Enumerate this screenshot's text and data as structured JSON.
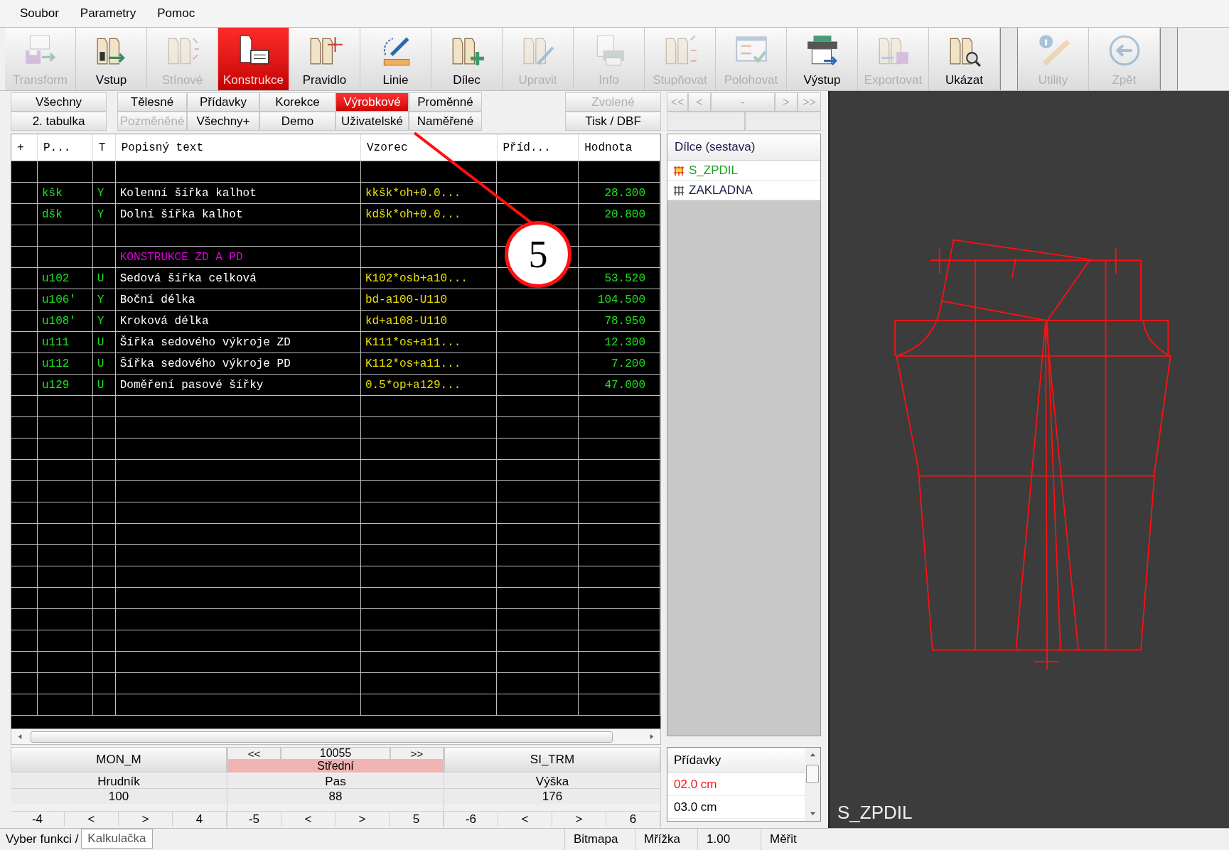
{
  "menu": [
    "Soubor",
    "Parametry",
    "Pomoc"
  ],
  "toolbar": [
    {
      "label": "Transform",
      "selected": false,
      "disabled": true
    },
    {
      "label": "Vstup",
      "selected": false,
      "disabled": false
    },
    {
      "label": "Stínové",
      "selected": false,
      "disabled": true
    },
    {
      "label": "Konstrukce",
      "selected": true,
      "disabled": false
    },
    {
      "label": "Pravidlo",
      "selected": false,
      "disabled": false
    },
    {
      "label": "Linie",
      "selected": false,
      "disabled": false
    },
    {
      "label": "Dílec",
      "selected": false,
      "disabled": false
    },
    {
      "label": "Upravit",
      "selected": false,
      "disabled": true
    },
    {
      "label": "Info",
      "selected": false,
      "disabled": true
    },
    {
      "label": "Stupňovat",
      "selected": false,
      "disabled": true
    },
    {
      "label": "Polohovat",
      "selected": false,
      "disabled": true
    },
    {
      "label": "Výstup",
      "selected": false,
      "disabled": false
    },
    {
      "label": "Exportovat",
      "selected": false,
      "disabled": true
    },
    {
      "label": "Ukázat",
      "selected": false,
      "disabled": false
    },
    {
      "label": "Utility",
      "selected": false,
      "disabled": true
    },
    {
      "label": "Zpět",
      "selected": false,
      "disabled": true
    }
  ],
  "filter_rows": [
    [
      {
        "label": "Všechny",
        "selected": false,
        "disabled": false
      },
      {
        "label": "Tělesné",
        "selected": false,
        "disabled": false
      },
      {
        "label": "Přídavky",
        "selected": false,
        "disabled": false
      },
      {
        "label": "Korekce",
        "selected": false,
        "disabled": false
      },
      {
        "label": "Výrobkové",
        "selected": true,
        "disabled": false
      },
      {
        "label": "Proměnné",
        "selected": false,
        "disabled": false
      },
      {
        "label": "Zvolené",
        "selected": false,
        "disabled": true
      }
    ],
    [
      {
        "label": "2. tabulka",
        "selected": false,
        "disabled": false
      },
      {
        "label": "Pozměněné",
        "selected": false,
        "disabled": true
      },
      {
        "label": "Všechny+",
        "selected": false,
        "disabled": false
      },
      {
        "label": "Demo",
        "selected": false,
        "disabled": false
      },
      {
        "label": "Uživatelské",
        "selected": false,
        "disabled": false
      },
      {
        "label": "Naměřené",
        "selected": false,
        "disabled": false
      },
      {
        "label": "Tisk / DBF",
        "selected": false,
        "disabled": false
      }
    ]
  ],
  "navigator": [
    "<<",
    "<",
    "-",
    ">",
    ">>"
  ],
  "table": {
    "columns": [
      "+",
      "P...",
      "T",
      "Popisný text",
      "Vzorec",
      "Příd...",
      "Hodnota"
    ],
    "rows": [
      {
        "kind": "empty"
      },
      {
        "kind": "data",
        "code": "kšk",
        "type": "Y",
        "text": "Kolenní šířka kalhot",
        "formula": "kkšk*oh+0.0...",
        "value": "28.300"
      },
      {
        "kind": "data",
        "code": "dšk",
        "type": "Y",
        "text": "Dolní šířka kalhot",
        "formula": "kdšk*oh+0.0...",
        "value": "20.800"
      },
      {
        "kind": "empty"
      },
      {
        "kind": "section",
        "text": "KONSTRUKCE ZD A PD"
      },
      {
        "kind": "data",
        "code": "u102",
        "type": "U",
        "text": "Sedová šířka celková",
        "formula": "K102*osb+a10...",
        "value": "53.520"
      },
      {
        "kind": "data",
        "code": "u106'",
        "type": "Y",
        "text": "Boční délka",
        "formula": "bd-a100-U110",
        "value": "104.500"
      },
      {
        "kind": "data",
        "code": "u108'",
        "type": "Y",
        "text": "Kroková délka",
        "formula": "kd+a108-U110",
        "value": "78.950"
      },
      {
        "kind": "data",
        "code": "u111",
        "type": "U",
        "text": "Šířka sedového výkroje ZD",
        "formula": "K111*os+a11...",
        "value": "12.300"
      },
      {
        "kind": "data",
        "code": "u112",
        "type": "U",
        "text": "Šířka sedového výkroje PD",
        "formula": "K112*os+a11...",
        "value": "7.200"
      },
      {
        "kind": "data",
        "code": "u129",
        "type": "U",
        "text": "Doměření pasové šířky",
        "formula": "0.5*op+a129...",
        "value": "47.000"
      }
    ]
  },
  "parts": {
    "title": "Dílce (sestava)",
    "items": [
      {
        "label": "S_ZPDIL",
        "selected": true
      },
      {
        "label": "ZAKLADNA",
        "selected": false
      }
    ]
  },
  "sizes": {
    "left": "MON_M",
    "prev": "<<",
    "number": "10055",
    "next": ">>",
    "size_name": "Střední",
    "right": "SI_TRM",
    "measures": [
      {
        "name": "Hrudník",
        "value": "100",
        "steps": [
          "-4",
          "<",
          ">",
          "4"
        ]
      },
      {
        "name": "Pas",
        "value": "88",
        "steps": [
          "-5",
          "<",
          ">",
          "5"
        ]
      },
      {
        "name": "Výška",
        "value": "176",
        "steps": [
          "-6",
          "<",
          ">",
          "6"
        ]
      }
    ]
  },
  "allowances": {
    "title": "Přídavky",
    "items": [
      {
        "label": "02.0 cm",
        "selected": true
      },
      {
        "label": "03.0 cm",
        "selected": false
      }
    ]
  },
  "canvas": {
    "label": "S_ZPDIL"
  },
  "callout": "5",
  "status_bar": {
    "label": "Vyber funkci /",
    "tab": "Kalkulačka",
    "fields": [
      "Bitmapa",
      "Mřížka",
      "1.00",
      "Měřit"
    ]
  }
}
